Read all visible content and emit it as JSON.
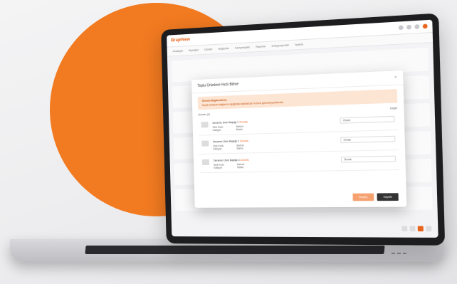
{
  "brand": {
    "logo_text": "BrajeNew",
    "accent": "#e8641b",
    "blob": "#f27a20"
  },
  "nav": {
    "items": [
      "Anasayfa",
      "Siparişler",
      "Ürünler",
      "Müşteriler",
      "Kampanyalar",
      "Raporlar",
      "Entegrasyonlar",
      "Ayarlar"
    ]
  },
  "modal": {
    "title": "Toplu Ürünlere Hızlı Bilme",
    "close_label": "×",
    "alert_title": "Önemli Bilgilendirme",
    "alert_text": "Seçili ürünlerin bilgilerini aşağıdaki alanlardan hızlıca güncelleyebilirsiniz.",
    "list_left": "Ürünler (3)",
    "list_right": "Değer",
    "items": [
      {
        "title": "Deneme Ürün Başlığı 1",
        "req": "Zorunlu",
        "meta1a": "Stok Kodu",
        "meta1b": "Barkod",
        "meta2a": "Kategori",
        "meta2b": "Marka",
        "value": "Örnek"
      },
      {
        "title": "Deneme Ürün Başlığı 2",
        "req": "Zorunlu",
        "meta1a": "Stok Kodu",
        "meta1b": "Barkod",
        "meta2a": "Kategori",
        "meta2b": "Marka",
        "value": "Örnek"
      },
      {
        "title": "Deneme Ürün Başlığı 3",
        "req": "Zorunlu",
        "meta1a": "Stok Kodu",
        "meta1b": "Barkod",
        "meta2a": "Kategori",
        "meta2b": "Marka",
        "value": "Örnek"
      }
    ],
    "cancel_label": "Vazgeç",
    "save_label": "Kaydet"
  }
}
